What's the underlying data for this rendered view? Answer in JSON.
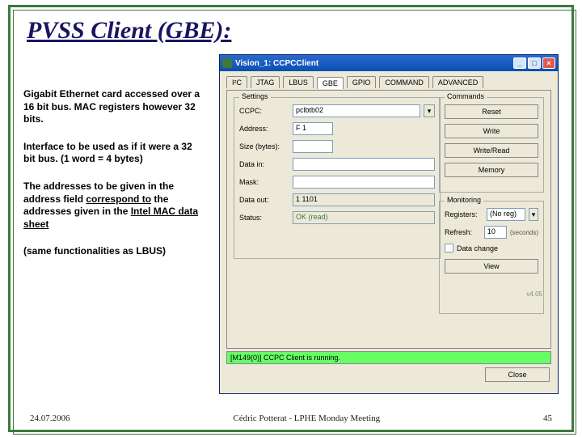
{
  "title": "PVSS Client (GBE):",
  "paragraphs": {
    "p1": "Gigabit Ethernet card accessed over a 16 bit bus. MAC registers however 32 bits.",
    "p2": "Interface to be used as if it were a 32 bit bus. (1 word = 4 bytes)",
    "p3a": "The addresses to be given in the address field ",
    "p3u": "correspond to",
    "p3b": " the addresses given in the ",
    "p3c": "Intel MAC data sheet",
    "p4": "(same functionalities as LBUS)"
  },
  "footer": {
    "date": "24.07.2006",
    "center": "Cédric Potterat - LPHE Monday Meeting",
    "page": "45"
  },
  "window": {
    "title": "Vision_1: CCPCClient",
    "tabs": [
      "I²C",
      "JTAG",
      "LBUS",
      "GBE",
      "GPIO",
      "COMMAND",
      "ADVANCED"
    ],
    "activeTab": "GBE",
    "groups": {
      "settings": "Settings",
      "commands": "Commands",
      "monitoring": "Monitoring"
    },
    "settings": {
      "ccpcLabel": "CCPC:",
      "ccpcValue": "pclbtb02",
      "addressLabel": "Address:",
      "addressValue": "F 1",
      "sizeLabel": "Size (bytes):",
      "sizeValue": "",
      "dataInLabel": "Data in:",
      "dataInValue": "",
      "maskLabel": "Mask:",
      "maskValue": "",
      "dataOutLabel": "Data out:",
      "dataOutValue": "1 1101",
      "statusLabel": "Status:",
      "statusValue": "OK (read)"
    },
    "commands": {
      "reset": "Reset",
      "write": "Write",
      "writeRead": "Write/Read",
      "memory": "Memory"
    },
    "monitoring": {
      "registersLabel": "Registers:",
      "registersValue": "(No reg)",
      "refreshLabel": "Refresh:",
      "refreshValue": "10",
      "refreshUnit": "(seconds)",
      "dataChange": "Data change",
      "view": "View"
    },
    "version": "v4.05",
    "statusBar": "[M149(0)] CCPC Client is running.",
    "close": "Close"
  }
}
